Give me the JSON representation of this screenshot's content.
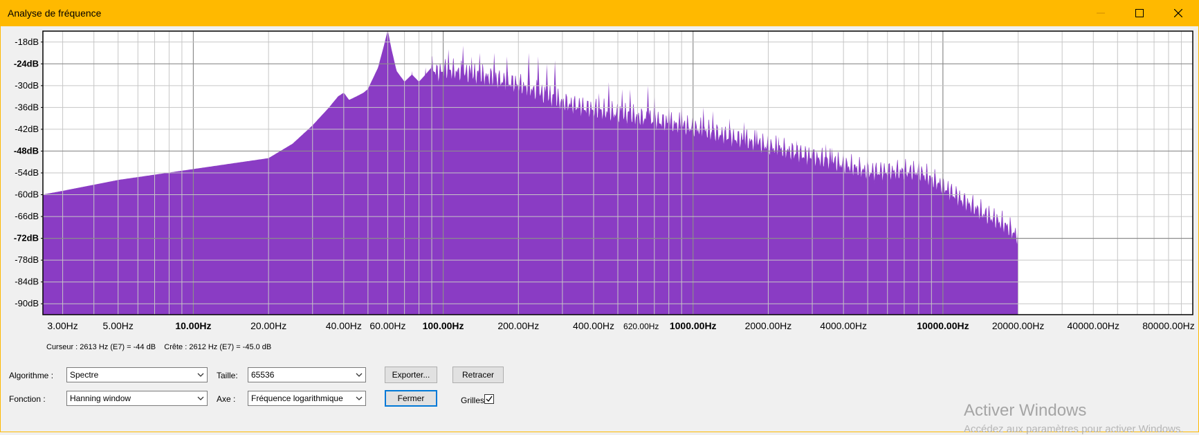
{
  "window": {
    "title": "Analyse de fréquence",
    "accent_color": "#ffb900",
    "controls": [
      "minimize-icon",
      "maximize-icon",
      "close-icon"
    ]
  },
  "chart_data": {
    "type": "area",
    "color": "#8a3cc4",
    "x_scale": "log",
    "xlim": [
      2.5,
      100000
    ],
    "ylim": [
      -93,
      -15
    ],
    "grid": true,
    "y_ticks": [
      {
        "label": "-18dB",
        "value": -18,
        "bold": false
      },
      {
        "label": "-24dB",
        "value": -24,
        "bold": true
      },
      {
        "label": "-30dB",
        "value": -30,
        "bold": false
      },
      {
        "label": "-36dB",
        "value": -36,
        "bold": false
      },
      {
        "label": "-42dB",
        "value": -42,
        "bold": false
      },
      {
        "label": "-48dB",
        "value": -48,
        "bold": true
      },
      {
        "label": "-54dB",
        "value": -54,
        "bold": false
      },
      {
        "label": "-60dB",
        "value": -60,
        "bold": false
      },
      {
        "label": "-66dB",
        "value": -66,
        "bold": false
      },
      {
        "label": "-72dB",
        "value": -72,
        "bold": true
      },
      {
        "label": "-78dB",
        "value": -78,
        "bold": false
      },
      {
        "label": "-84dB",
        "value": -84,
        "bold": false
      },
      {
        "label": "-90dB",
        "value": -90,
        "bold": false
      }
    ],
    "x_ticks": [
      {
        "label": "3.00Hz",
        "value": 3,
        "bold": false,
        "small": false
      },
      {
        "label": "5.00Hz",
        "value": 5,
        "bold": false,
        "small": false
      },
      {
        "label": "10.00Hz",
        "value": 10,
        "bold": true,
        "small": false
      },
      {
        "label": "20.00Hz",
        "value": 20,
        "bold": false,
        "small": false
      },
      {
        "label": "40.00Hz",
        "value": 40,
        "bold": false,
        "small": false
      },
      {
        "label": "60.00Hz",
        "value": 60,
        "bold": false,
        "small": false
      },
      {
        "label": "100.00Hz",
        "value": 100,
        "bold": true,
        "small": false
      },
      {
        "label": "200.00Hz",
        "value": 200,
        "bold": false,
        "small": false
      },
      {
        "label": "400.00Hz",
        "value": 400,
        "bold": false,
        "small": false
      },
      {
        "label": "620.00Hz",
        "value": 620,
        "bold": false,
        "small": true
      },
      {
        "label": "1000.00Hz",
        "value": 1000,
        "bold": true,
        "small": false
      },
      {
        "label": "2000.00Hz",
        "value": 2000,
        "bold": false,
        "small": false
      },
      {
        "label": "4000.00Hz",
        "value": 4000,
        "bold": false,
        "small": false
      },
      {
        "label": "10000.00Hz",
        "value": 10000,
        "bold": true,
        "small": false
      },
      {
        "label": "20000.00Hz",
        "value": 20000,
        "bold": false,
        "small": false
      },
      {
        "label": "40000.00Hz",
        "value": 40000,
        "bold": false,
        "small": false
      },
      {
        "label": "80000.00Hz",
        "value": 80000,
        "bold": false,
        "small": false
      }
    ],
    "envelope": {
      "x": [
        2.5,
        3,
        5,
        10,
        20,
        25,
        30,
        35,
        38,
        40,
        42,
        45,
        48,
        50,
        55,
        58,
        60,
        62,
        65,
        70,
        75,
        80,
        85,
        90,
        95,
        100,
        150,
        200,
        300,
        400,
        600,
        1000,
        2000,
        3000,
        4000,
        5000,
        6000,
        8000,
        10000,
        12000,
        15000,
        18000,
        20000
      ],
      "y": [
        -60,
        -59,
        -56,
        -53,
        -50,
        -46,
        -41,
        -36,
        -33,
        -32,
        -34,
        -33,
        -32,
        -31,
        -25,
        -19,
        -15,
        -20,
        -26,
        -29,
        -27,
        -29,
        -27,
        -25,
        -27,
        -26,
        -28,
        -30,
        -35,
        -37,
        -39,
        -42,
        -47,
        -50,
        -52,
        -54,
        -54,
        -54,
        -58,
        -62,
        -66,
        -69,
        -72
      ]
    },
    "peaks": {
      "x": [
        75,
        85,
        105,
        120,
        130,
        140,
        160,
        180,
        220,
        240,
        260,
        280,
        420,
        460,
        520,
        560,
        660,
        700,
        800,
        900,
        1100,
        1200,
        1400,
        1600,
        1800,
        2200,
        2600,
        3000,
        3400,
        3600,
        5000
      ],
      "y": [
        -26,
        -25,
        -20,
        -19,
        -22,
        -21,
        -21,
        -22,
        -21,
        -22,
        -24,
        -23,
        -32,
        -29,
        -31,
        -31,
        -30,
        -32,
        -35,
        -35,
        -36,
        -37,
        -39,
        -40,
        -42,
        -44,
        -45,
        -46,
        -46,
        -47,
        -49
      ]
    }
  },
  "status": "Curseur : 2613 Hz (E7) = -44 dB    Crête : 2612 Hz (E7) = -45.0 dB",
  "controls": {
    "algorithm_label": "Algorithme :",
    "algorithm_value": "Spectre",
    "size_label": "Taille:",
    "size_value": "65536",
    "function_label": "Fonction :",
    "function_value": "Hanning window",
    "axis_label": "Axe :",
    "axis_value": "Fréquence logarithmique",
    "export_label": "Exporter...",
    "replot_label": "Retracer",
    "close_label": "Fermer",
    "grids_label": "Grilles",
    "grids_checked": true
  },
  "watermark": {
    "line1": "Activer Windows",
    "line2": "Accédez aux paramètres pour activer Windows."
  }
}
